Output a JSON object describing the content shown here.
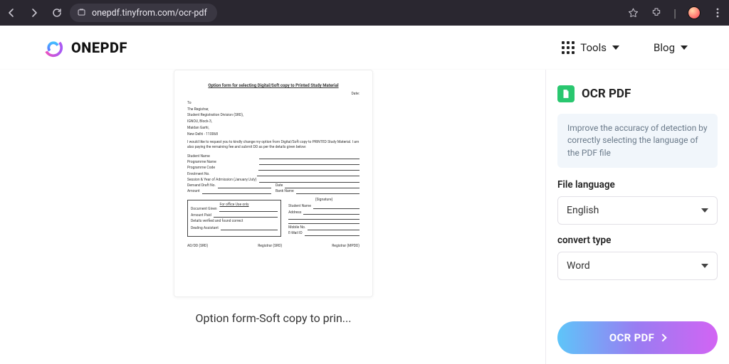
{
  "chrome": {
    "url": "onepdf.tinyfrom.com/ocr-pdf"
  },
  "header": {
    "brand": "ONEPDF",
    "tools_label": "Tools",
    "blog_label": "Blog"
  },
  "card": {
    "caption": "Option form-Soft copy to prin...",
    "doc": {
      "title": "Option form for selecting Digital/Soft copy to Printed Study Material",
      "date_label": "Date:",
      "to": "To",
      "l1": "The Registrar,",
      "l2": "Student Registration Division (SRD),",
      "l3": "IGNOU, Block-3,",
      "l4": "Maidan Garhi,",
      "l5": "New Delhi - 110068",
      "para": "I would like to request you to kindly change my option from Digital/Soft copy to PRINTED Study Material. I am also paying the remaining fee and submit DD as per the details given below:",
      "f1": "Student Name",
      "f2": "Programme Name",
      "f3": "Programme Code",
      "f4": "Enrolment No.",
      "f5": "Session & Year of Admission (January/July)",
      "f6": "Demand Draft No.",
      "f6b": "Date",
      "f7": "Amount",
      "f7b": "Bank Name",
      "box_head_left": "For office Use only",
      "sig": "(Signature)",
      "b1": "Document Given",
      "r1": "Student Name",
      "b2": "Amount Paid",
      "r2": "Address",
      "b3": "Details verified and found correct",
      "b4": "Dealing Assistant",
      "r4": "Mobile No.",
      "r5": "E-Mail ID",
      "ft1": "AD/DD (SRD)",
      "ft2": "Registrar (SRD)",
      "ft3": "Registrar (MPDD)"
    }
  },
  "side": {
    "title": "OCR PDF",
    "notice": "Improve the accuracy of detection by correctly selecting the language of the PDF file",
    "lang_label": "File language",
    "lang_value": "English",
    "type_label": "convert type",
    "type_value": "Word",
    "cta": "OCR PDF"
  }
}
